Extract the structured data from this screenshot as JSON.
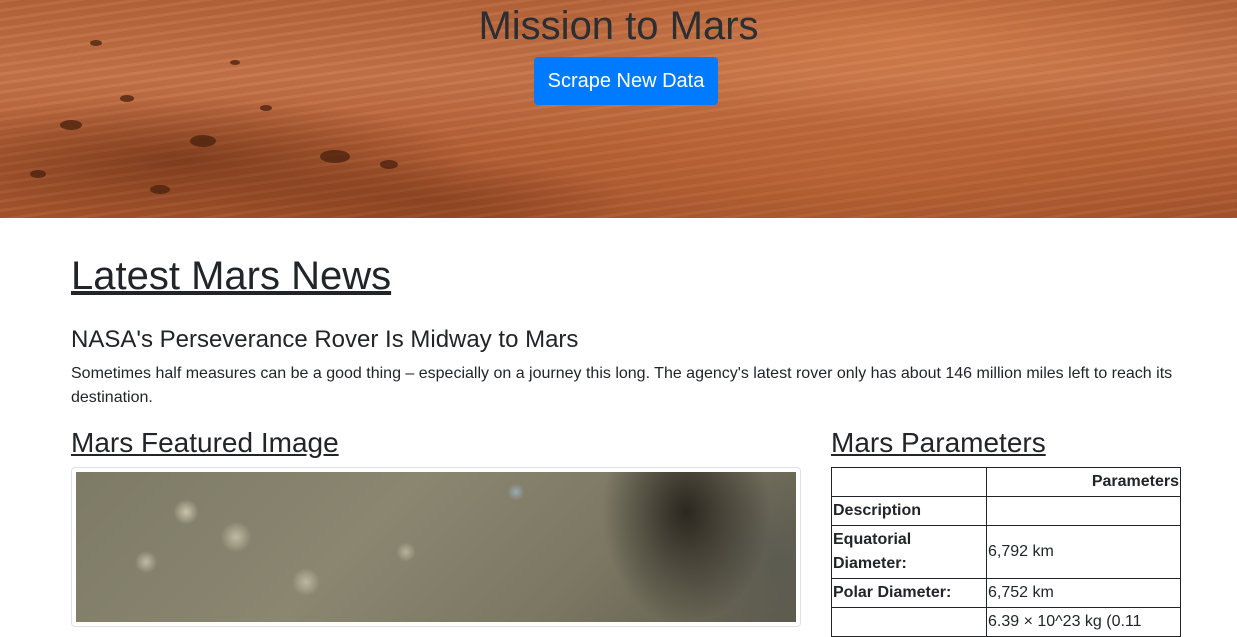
{
  "header": {
    "title": "Mission to Mars",
    "scrape_button_label": "Scrape New Data"
  },
  "news": {
    "section_title": "Latest Mars News",
    "headline": "NASA's Perseverance Rover Is Midway to Mars",
    "teaser": "Sometimes half measures can be a good thing – especially on a journey this long. The agency's latest rover only has about 146 million miles left to reach its destination."
  },
  "featured_image": {
    "section_title": "Mars Featured Image"
  },
  "mars_facts": {
    "section_title": "Mars Parameters",
    "column_header": "Parameters",
    "rows": [
      {
        "label": "Description",
        "value": ""
      },
      {
        "label": "Equatorial Diameter:",
        "value": "6,792 km"
      },
      {
        "label": "Polar Diameter:",
        "value": "6,752 km"
      },
      {
        "label": "",
        "value": "6.39 × 10^23 kg (0.11"
      }
    ]
  }
}
